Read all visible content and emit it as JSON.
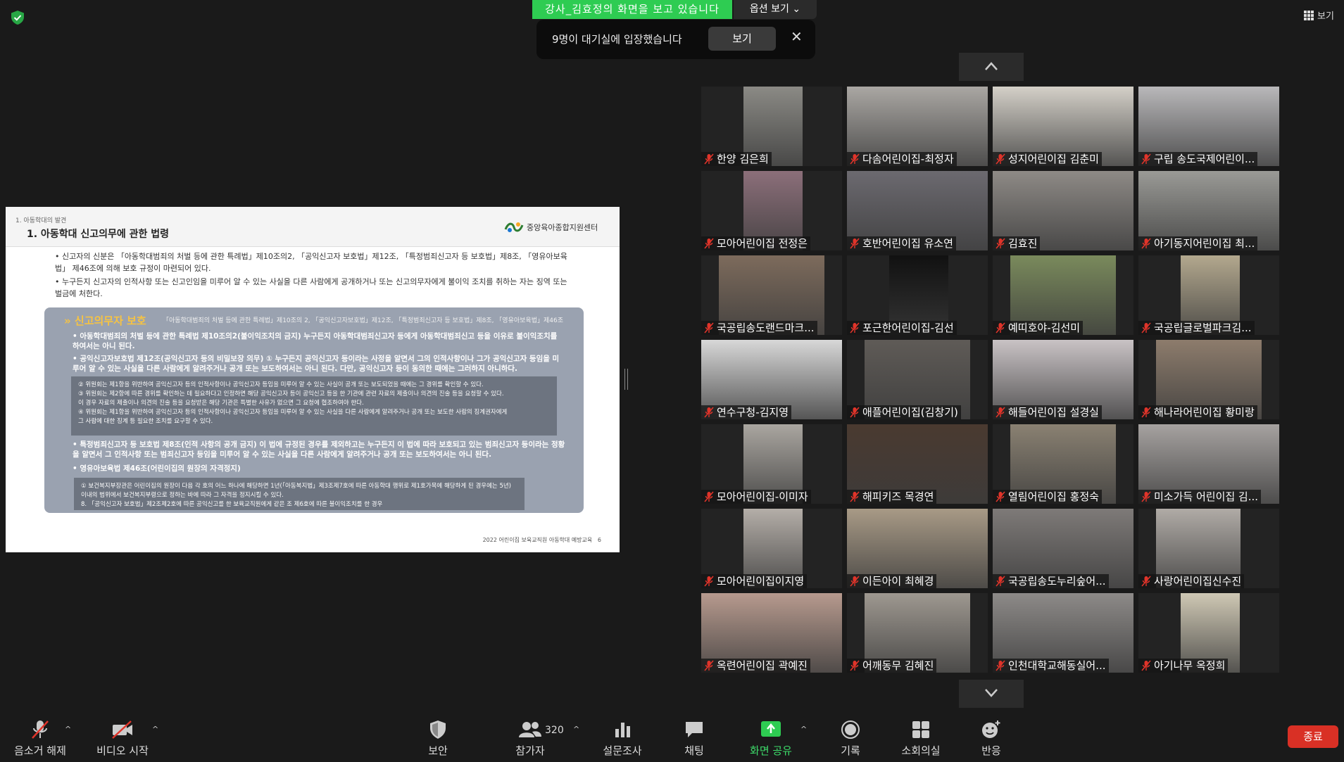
{
  "share_banner": "강사_김효정의 화면을 보고 있습니다",
  "view_options": "옵션 보기",
  "waiting_toast": {
    "message": "9명이 대기실에 입장했습니다",
    "view_button": "보기",
    "close": "✕"
  },
  "gallery_view_label": "보기",
  "slide": {
    "section": "1. 아동학대의 발견",
    "title": "1. 아동학대 신고의무에 관한 법령",
    "org": "중앙육아종합지원센터",
    "bullets": [
      "• 신고자의 신분은 「아동학대범죄의 처벌 등에 관한 특례법」제10조의2, 「공익신고자 보호법」제12조, 「특정범죄신고자 등 보호법」제8조, 「영유아보육법」 제46조에 의해 보호 규정이 마련되어 있다.",
      "• 누구든지 신고자의 인적사항 또는 신고인임을 미루어 알 수 있는 사실을 다른 사람에게 공개하거나 또는 신고의무자에게 불이익 조치를 취하는 자는 징역 또는 벌금에 처한다."
    ],
    "box_title": "» 신고의무자 보호",
    "box_sub": "「아동학대범죄의 처벌 등에 관한 특례법」제10조의 2, 「공익신고자보호법」제12조, 「특정범죄신고자 등 보호법」제8조, 「영유아보육법」제46조",
    "box_bullets": [
      "• 아동학대범죄의 처벌 등에 관한 특례법 제10조의2(불이익조치의 금지) 누구든지 아동학대범죄신고자 등에게 아동학대범죄신고 등을 이유로 불이익조치를 하여서는 아니 된다.",
      "• 공익신고자보호법 제12조(공익신고자 등의 비밀보장 의무) ① 누구든지 공익신고자 등이라는 사정을 알면서 그의 인적사항이나 그가 공익신고자 등임을 미루어 알 수 있는 사실을 다른 사람에게 알려주거나 공개 또는 보도하여서는 아니 된다. 다만, 공익신고자 등이 동의한 때에는 그러하지 아니하다.",
      "• 특정범죄신고자 등 보호법 제8조(인적 사항의 공개 금지) 이 법에 규정된 경우를 제외하고는 누구든지 이 법에 따라 보호되고 있는 범죄신고자 등이라는 정황을 알면서 그 인적사항 또는 범죄신고자 등임을 미루어 알 수 있는 사실을 다른 사람에게 알려주거나 공개 또는 보도하여서는 아니 된다.",
      "• 영유아보육법 제46조(어린이집의 원장의 자격정지)"
    ],
    "inner1": [
      "② 위원회는 제1항을 위반하여 공익신고자 등의 인적사항이나 공익신고자 등임을 미루어 알 수 있는 사실이 공개 또는 보도되었을 때에는 그 경위를 확인할 수 있다.",
      "③ 위원회는 제2항에 따른 경위를 확인하는 데 필요하다고 인정하면 해당 공익신고자 등이 공익신고 등을 한 기관에 관련 자료의 제출이나 의견의 진술 등을 요청할 수 있다.",
      "이 경우 자료의 제출이나 의견의 진술 등을 요청받은 해당 기관은 특별한 사유가 없으면 그 요청에 협조하여야 한다.",
      "④ 위원회는 제1항을 위반하여 공익신고자 등의 인적사항이나 공익신고자 등임을 미루어 알 수 있는 사실을 다른 사람에게 알려주거나 공개 또는 보도한 사람의 징계권자에게",
      "그 사람에 대한 징계 등 필요한 조치를 요구할 수 있다."
    ],
    "inner2": [
      "① 보건복지부장관은 어린이집의 원장이 다음 각 호의 어느 하나에 해당하면 1년(「아동복지법」제3조제7호에 따른 아동학대 행위로 제1호가목에 해당하게 된 경우에는 5년)",
      "이내의 범위에서 보건복지부령으로 정하는 바에 따라 그 자격을 정지시킬 수 있다.",
      "8. 「공익신고자 보호법」제2조제2호에 따른 공익신고를 한 보육교직원에게 같은 조 제6호에 따른 불이익조치를 한 경우"
    ],
    "footer_text": "2022 어린이집 보육교직원",
    "footer_strong": "아동학대 예방교육",
    "page_number": "6"
  },
  "participants": [
    "한양 김은희",
    "다솜어린이집-최정자",
    "성지어린이집 김춘미",
    "구립 송도국제어린이...",
    "모아어린이집 전정은",
    "호반어린이집 유소연",
    "김효진",
    "아기동지어린이집 최...",
    "국공립송도랜드마크...",
    "포근한어린이집-김선",
    "예띠호야-김선미",
    "국공립글로벌파크김...",
    "연수구청-김지영",
    "애플어린이집(김창기)",
    "해들어린이집 설경실",
    "해나라어린이집 황미랑",
    "모아어린이집-이미자",
    "해피키즈 목경연",
    "열림어린이집 홍정숙",
    "미소가득 어린이집 김...",
    "모아어린이집이지영",
    "이든아이 최혜경",
    "국공립송도누리숲어...",
    "사랑어린이집신수진",
    "옥련어린이집 곽예진",
    "어깨동무 김혜진",
    "인천대학교해동실어...",
    "아기나무 옥정희"
  ],
  "toolbar": {
    "unmute": "음소거 해제",
    "start_video": "비디오 시작",
    "security": "보안",
    "participants": "참가자",
    "participants_count": "320",
    "polls": "설문조사",
    "chat": "채팅",
    "share_screen": "화면 공유",
    "record": "기록",
    "breakout": "소회의실",
    "reactions": "반응",
    "end": "종료"
  },
  "colors": {
    "share_green": "#2ecc52",
    "end_red": "#d93025",
    "muted_red": "#e0342a"
  }
}
